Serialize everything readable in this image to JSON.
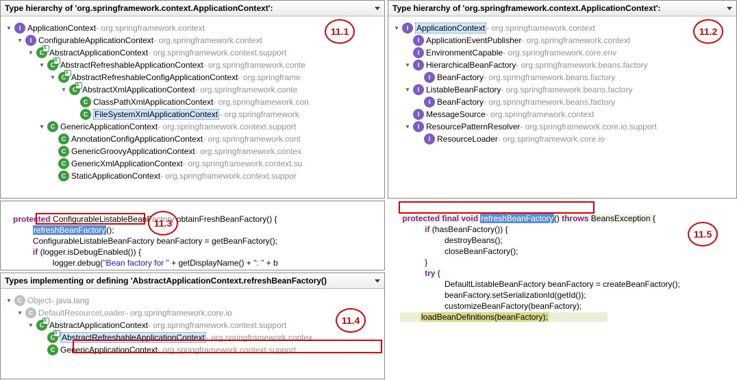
{
  "panels": {
    "p1": {
      "title_prefix": "Type hierarchy of '",
      "title_class": "org.springframework.context.ApplicationContext",
      "title_suffix": "':",
      "annot": "11.1"
    },
    "p2": {
      "title_prefix": "Type hierarchy of '",
      "title_class": "org.springframework.context.ApplicationContext",
      "title_suffix": "':",
      "annot": "11.2"
    },
    "p3": {
      "annot": "11.3"
    },
    "p4": {
      "title": "Types implementing or defining 'AbstractApplicationContext.refreshBeanFactory()",
      "annot": "11.4"
    },
    "p5": {
      "annot": "11.5"
    }
  },
  "tree1": [
    {
      "d": 0,
      "ar": "▾",
      "ic": "i",
      "nm": "ApplicationContext",
      "pk": "org.springframework.context"
    },
    {
      "d": 1,
      "ar": "▾",
      "ic": "i",
      "nm": "ConfigurableApplicationContext",
      "pk": "org.springframework.context"
    },
    {
      "d": 2,
      "ar": "▾",
      "ic": "ca",
      "nm": "AbstractApplicationContext",
      "pk": "org.springframework.context.support"
    },
    {
      "d": 3,
      "ar": "▾",
      "ic": "ca",
      "nm": "AbstractRefreshableApplicationContext",
      "pk": "org.springframework.conte"
    },
    {
      "d": 4,
      "ar": "▾",
      "ic": "ca",
      "nm": "AbstractRefreshableConfigApplicationContext",
      "pk": "org.springframe"
    },
    {
      "d": 5,
      "ar": "▾",
      "ic": "ca",
      "nm": "AbstractXmlApplicationContext",
      "pk": "org.springframework.conte"
    },
    {
      "d": 6,
      "ar": "",
      "ic": "c",
      "nm": "ClassPathXmlApplicationContext",
      "pk": "org.springframework.con"
    },
    {
      "d": 6,
      "ar": "",
      "ic": "c",
      "nm": "FileSystemXmlApplicationContext",
      "pk": "org.springframework",
      "sel": 1
    },
    {
      "d": 3,
      "ar": "▾",
      "ic": "c",
      "nm": "GenericApplicationContext",
      "pk": "org.springframework.context.support"
    },
    {
      "d": 4,
      "ar": "",
      "ic": "c",
      "nm": "AnnotationConfigApplicationContext",
      "pk": "org.springframework.cont"
    },
    {
      "d": 4,
      "ar": "",
      "ic": "c",
      "nm": "GenericGroovyApplicationContext",
      "pk": "org.springframework.contex"
    },
    {
      "d": 4,
      "ar": "",
      "ic": "c",
      "nm": "GenericXmlApplicationContext",
      "pk": "org.springframework.context.su"
    },
    {
      "d": 4,
      "ar": "",
      "ic": "c",
      "nm": "StaticApplicationContext",
      "pk": "org.springframework.context.suppor"
    }
  ],
  "tree2": [
    {
      "d": 0,
      "ar": "▾",
      "ic": "i",
      "nm": "ApplicationContext",
      "pk": "org.springframework.context",
      "sel": 1
    },
    {
      "d": 1,
      "ar": "",
      "ic": "i",
      "nm": "ApplicationEventPublisher",
      "pk": "org.springframework.context"
    },
    {
      "d": 1,
      "ar": "",
      "ic": "i",
      "nm": "EnvironmentCapable",
      "pk": "org.springframework.core.env"
    },
    {
      "d": 1,
      "ar": "▾",
      "ic": "i",
      "nm": "HierarchicalBeanFactory",
      "pk": "org.springframework.beans.factory"
    },
    {
      "d": 2,
      "ar": "",
      "ic": "i",
      "nm": "BeanFactory",
      "pk": "org.springframework.beans.factory"
    },
    {
      "d": 1,
      "ar": "▾",
      "ic": "i",
      "nm": "ListableBeanFactory",
      "pk": "org.springframework.beans.factory"
    },
    {
      "d": 2,
      "ar": "",
      "ic": "i",
      "nm": "BeanFactory",
      "pk": "org.springframework.beans.factory"
    },
    {
      "d": 1,
      "ar": "",
      "ic": "i",
      "nm": "MessageSource",
      "pk": "org.springframework.context"
    },
    {
      "d": 1,
      "ar": "▾",
      "ic": "i",
      "nm": "ResourcePatternResolver",
      "pk": "org.springframework.core.io.support"
    },
    {
      "d": 2,
      "ar": "",
      "ic": "i",
      "nm": "ResourceLoader",
      "pk": "org.springframework.core.io"
    }
  ],
  "tree3": [
    {
      "d": 0,
      "ar": "▾",
      "ic": "cg",
      "nm": "Object",
      "pk": "java.lang",
      "gray": 1
    },
    {
      "d": 1,
      "ar": "▾",
      "ic": "cg",
      "nm": "DefaultResourceLoader",
      "pk": "org.springframework.core.io",
      "gray": 1
    },
    {
      "d": 2,
      "ar": "▾",
      "ic": "ca",
      "nm": "AbstractApplicationContext",
      "pk": "org.springframework.context.support"
    },
    {
      "d": 3,
      "ar": "",
      "ic": "ca",
      "nm": "AbstractRefreshableApplicationContext",
      "pk": "org.springframework.contex",
      "sel": 1
    },
    {
      "d": 3,
      "ar": "",
      "ic": "c",
      "nm": "GenericApplicationContext",
      "pk": "org.springframework.context.support"
    }
  ],
  "code1": {
    "l1a": "protected",
    "l1b": " ConfigurableListableBeanFactory obtainFreshBeanFactory() {",
    "l2a": "refreshBeanFactory",
    "l2b": "();",
    "l3": "ConfigurableListableBeanFactory beanFactory = getBeanFactory();",
    "l4a": "if",
    "l4b": " (logger.isDebugEnabled()) {",
    "l5a": "logger.debug(",
    "l5b": "\"Bean factory for \"",
    "l5c": " + getDisplayName() + ",
    "l5d": "\": \"",
    "l5e": " + b"
  },
  "code2": {
    "l1a": "protected final void",
    "l1b": "refreshBeanFactory",
    "l1c": "()",
    "l1d": "throws",
    "l1e": " BeansException {",
    "l2a": "if",
    "l2b": " (hasBeanFactory()) {",
    "l3": "destroyBeans();",
    "l4": "closeBeanFactory();",
    "l5": "}",
    "l6a": "try",
    "l6b": " {",
    "l7": "DefaultListableBeanFactory beanFactory = createBeanFactory();",
    "l8": "beanFactory.setSerializationId(getId());",
    "l9": "customizeBeanFactory(beanFactory);",
    "l10": "loadBeanDefinitions(beanFactory);"
  }
}
